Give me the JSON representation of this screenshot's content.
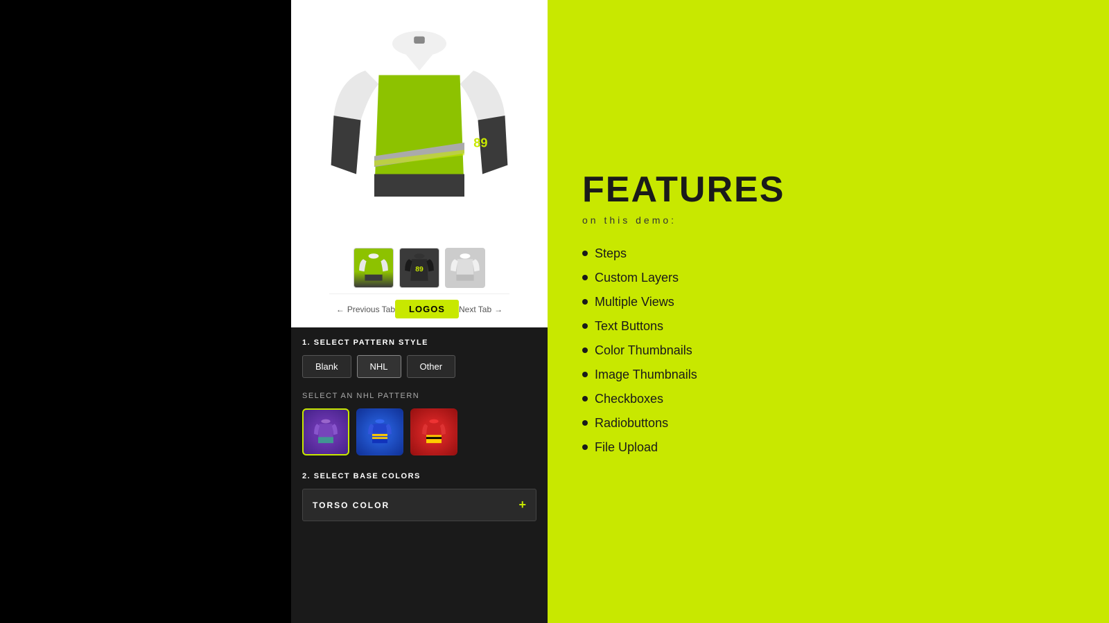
{
  "leftPanel": {},
  "centerPanel": {
    "tabNav": {
      "prevLabel": "Previous Tab",
      "currentLabel": "LOGOS",
      "nextLabel": "Next Tab"
    },
    "step1": {
      "title": "1. SELECT PATTERN STYLE",
      "buttons": [
        {
          "label": "Blank",
          "active": false
        },
        {
          "label": "NHL",
          "active": true
        },
        {
          "label": "Other",
          "active": false
        }
      ]
    },
    "nhlSection": {
      "title": "SELECT AN NHL PATTERN",
      "patterns": [
        {
          "id": "purple",
          "selected": true
        },
        {
          "id": "blue",
          "selected": false
        },
        {
          "id": "red",
          "selected": false
        }
      ]
    },
    "step2": {
      "title": "2. SELECT BASE COLORS",
      "torsoLabel": "TORSO COLOR",
      "plusIcon": "+"
    }
  },
  "rightPanel": {
    "title": "FEATURES",
    "subtitle": "on this demo:",
    "features": [
      {
        "label": "Steps"
      },
      {
        "label": "Custom Layers"
      },
      {
        "label": "Multiple Views"
      },
      {
        "label": "Text Buttons"
      },
      {
        "label": "Color Thumbnails"
      },
      {
        "label": "Image Thumbnails"
      },
      {
        "label": "Checkboxes"
      },
      {
        "label": "Radiobuttons"
      },
      {
        "label": "File Upload"
      }
    ]
  }
}
